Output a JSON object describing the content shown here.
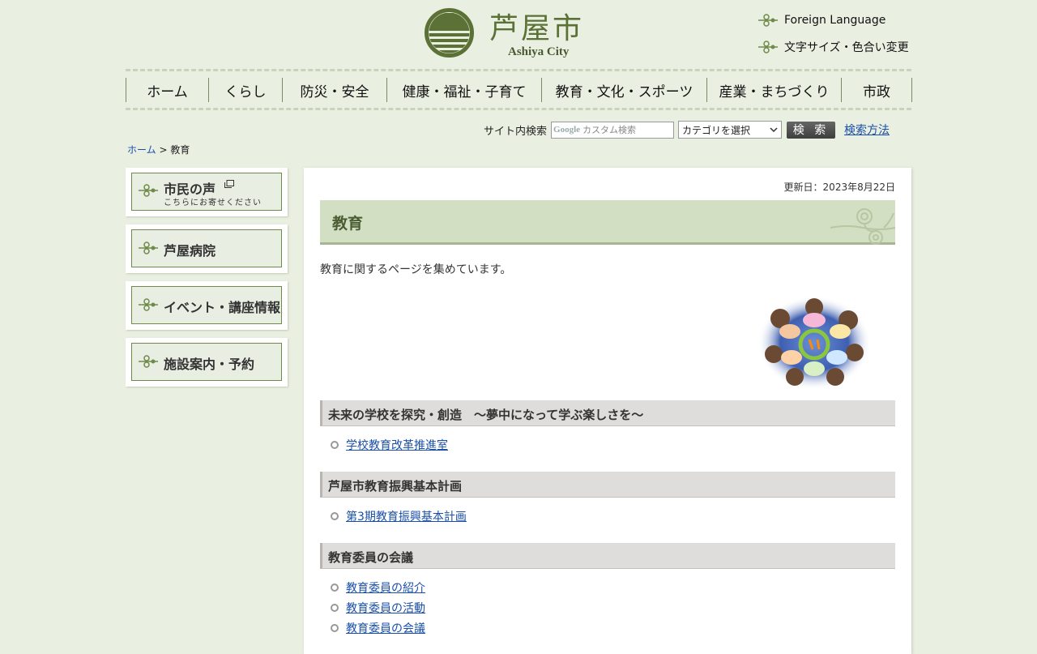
{
  "header": {
    "logo_jp": "芦屋市",
    "logo_en": "Ashiya City",
    "util_links": [
      "Foreign Language",
      "文字サイズ・色合い変更"
    ]
  },
  "nav": {
    "items": [
      "ホーム",
      "くらし",
      "防災・安全",
      "健康・福祉・子育て",
      "教育・文化・スポーツ",
      "産業・まちづくり",
      "市政"
    ]
  },
  "search": {
    "label": "サイト内検索",
    "brand": "Google",
    "placeholder": "カスタム検索",
    "category": "カテゴリを選択",
    "button": "検 索",
    "help": "検索方法"
  },
  "breadcrumb": {
    "home": "ホーム",
    "separator": ">",
    "current": "教育"
  },
  "sidebar": {
    "items": [
      {
        "title": "市民の声",
        "sub": "こちらにお寄せください"
      },
      {
        "title": "芦屋病院"
      },
      {
        "title": "イベント・講座情報"
      },
      {
        "title": "施設案内・予約"
      }
    ]
  },
  "main": {
    "updated": "更新日：2023年8月22日",
    "heading": "教育",
    "intro": "教育に関するページを集めています。",
    "sections": [
      {
        "title": "未来の学校を探究・創造　～夢中になって学ぶ楽しさを～",
        "links": [
          "学校教育改革推進室"
        ]
      },
      {
        "title": "芦屋市教育振興基本計画",
        "links": [
          "第3期教育振興基本計画"
        ]
      },
      {
        "title": "教育委員の会議",
        "links": [
          "教育委員の紹介",
          "教育委員の活動",
          "教育委員の会議"
        ]
      }
    ]
  },
  "colors": {
    "background": "#e9efe1",
    "accent": "#5c7136",
    "link": "#1a4fa8"
  }
}
